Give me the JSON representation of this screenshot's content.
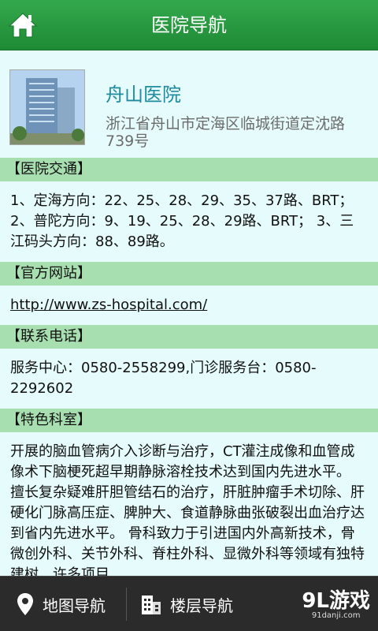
{
  "header": {
    "title": "医院导航"
  },
  "hospital": {
    "name": "舟山医院",
    "address": "浙江省舟山市定海区临城街道定沈路739号"
  },
  "sections": [
    {
      "title": "【医院交通】",
      "body": "1、定海方向：22、25、28、29、35、37路、BRT； 2、普陀方向：9、19、25、28、29路、BRT； 3、三江码头方向：88、89路。"
    },
    {
      "title": "【官方网站】",
      "link": "http://www.zs-hospital.com/"
    },
    {
      "title": "【联系电话】",
      "body": "服务中心：0580-2558299,门诊服务台：0580-2292602"
    },
    {
      "title": "【特色科室】",
      "body": "开展的脑血管病介入诊断与治疗，CT灌注成像和血管成像术下脑梗死超早期静脉溶栓技术达到国内先进水平。 擅长复杂疑难肝胆管结石的治疗，肝脏肿瘤手术切除、肝硬化门脉高压症、脾肿大、食道静脉曲张破裂出血治疗达到省内先进水平。 骨科致力于引进国内外高新技术，骨微创外科、关节外科、脊柱外科、显微外科等领域有独特建树，许多项目"
    }
  ],
  "footer": {
    "map_nav": "地图导航",
    "floor_nav": "楼层导航"
  },
  "watermark": {
    "main": "9L游戏",
    "sub": "91danji.com"
  },
  "colors": {
    "header_green": "#2a9d44",
    "section_header": "#a7dfb1",
    "content_bg": "#e6fbfb",
    "hospital_name": "#1e8ba0"
  }
}
